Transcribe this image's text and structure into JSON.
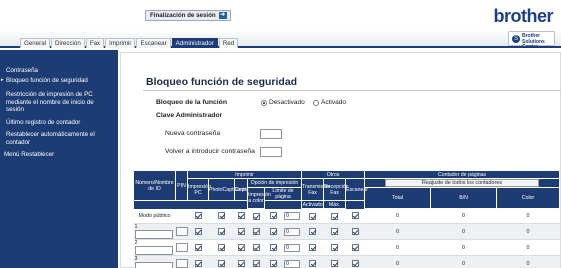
{
  "header": {
    "logout_label": "Finalización de sesión",
    "brand": "brother",
    "solutions_line1": "Brother",
    "solutions_line2": "Solutions Center"
  },
  "tabs": [
    "General",
    "Dirección",
    "Fax",
    "Imprimir",
    "Escanear",
    "Administrador",
    "Red"
  ],
  "active_tab": "Administrador",
  "sidebar": {
    "items": [
      "Contraseña",
      "Bloqueo función de seguridad",
      "Restricción de impresión de PC",
      "mediante el nombre de inicio de",
      "sesión",
      "Último registro de contador",
      "Restablecer automáticamente el",
      "contador",
      "Menú Restablecer"
    ]
  },
  "main": {
    "title": "Bloqueo función de seguridad",
    "lock_label": "Bloqueo de la función",
    "radio_off": "Desactivado",
    "radio_on": "Activado",
    "radio_selected": "Desactivado",
    "admin_key_label": "Clave Administrador",
    "new_password_label": "Nueva contraseña",
    "retype_password_label": "Volver a introducir contraseña"
  },
  "table": {
    "group_headers": {
      "imprimir": "Imprimir",
      "otros": "Otros",
      "contador": "Contador de páginas"
    },
    "col_id": "Número/Nombre de ID",
    "col_pin": "PIN",
    "col_print_pc": "Impresión PC",
    "col_photocapture": "PhotoCaptCentr",
    "col_copy": "Copia",
    "print_option": "Opción de impresión",
    "col_color_print": "Impresión a color",
    "page_limit": "Límite de página",
    "col_enabled": "Activado",
    "col_max": "Máx.",
    "col_fax_tx": "Transmisión Fax",
    "col_fax_rx": "Recepción Fax",
    "col_scan": "Escanear",
    "reset_all_button": "Reajuste de todos los contadores",
    "col_total": "Total",
    "col_bn": "B/N",
    "col_color": "Color",
    "rows": [
      {
        "id": "Modo público",
        "limit": "0",
        "total": "0",
        "bn": "0",
        "color": "0"
      },
      {
        "id": "1",
        "limit": "0",
        "total": "0",
        "bn": "0",
        "color": "0"
      },
      {
        "id": "2",
        "limit": "0",
        "total": "0",
        "bn": "0",
        "color": "0"
      },
      {
        "id": "3",
        "limit": "0",
        "total": "0",
        "bn": "0",
        "color": "0"
      }
    ]
  }
}
